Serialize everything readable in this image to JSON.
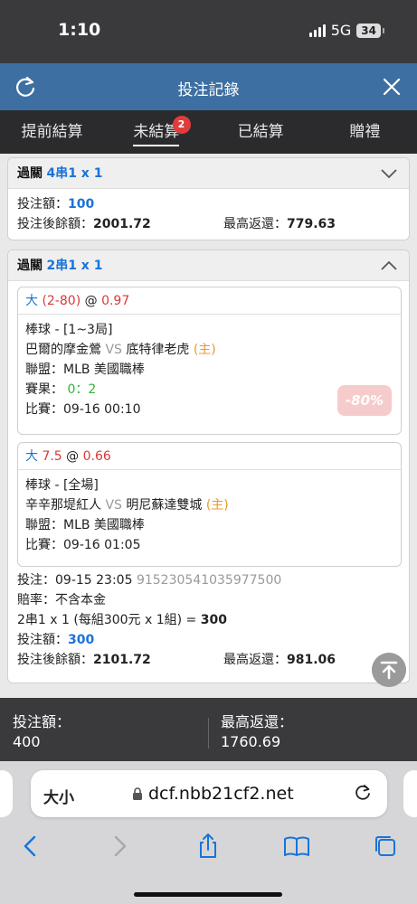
{
  "status": {
    "time": "1:10",
    "network": "5G",
    "battery": "34"
  },
  "header": {
    "title": "投注記錄"
  },
  "tabs": [
    {
      "label": "提前結算"
    },
    {
      "label": "未結算",
      "badge": "2"
    },
    {
      "label": "已結算"
    },
    {
      "label": "贈禮"
    }
  ],
  "card1": {
    "type": "過關",
    "combo": "4串1 x 1",
    "stake_label": "投注額：",
    "stake": "100",
    "balance_label": "投注後餘額：",
    "balance": "2001.72",
    "max_return_label": "最高返還：",
    "max_return": "779.63"
  },
  "card2": {
    "type": "過關",
    "combo": "2串1 x 1",
    "legs": [
      {
        "pick": "大",
        "line": "(2-80)",
        "at": "@",
        "odds": "0.97",
        "sport": "棒球 - [1~3局]",
        "home": "巴爾的摩金鶯",
        "vs": "VS",
        "away": "底特律老虎",
        "host": "(主)",
        "league": "聯盟：MLB 美國職棒",
        "result_label": "賽果：",
        "result": "0：2",
        "match": "比賽：09-16 00:10",
        "stamp": "-80%"
      },
      {
        "pick": "大",
        "line": "7.5",
        "at": "@",
        "odds": "0.66",
        "sport": "棒球 - [全場]",
        "home": "辛辛那堤紅人",
        "vs": "VS",
        "away": "明尼蘇達雙城",
        "host": "(主)",
        "league": "聯盟：MLB 美國職棒",
        "match": "比賽：09-16 01:05"
      }
    ],
    "bet_time": "投注：09-15 23:05",
    "bet_id": "915230541035977500",
    "odds_note": "賠率：不含本金",
    "combo_calc": "2串1 x 1 (每組300元 x 1組) = ",
    "combo_total": "300",
    "stake_label": "投注額：",
    "stake": "300",
    "balance_label": "投注後餘額：",
    "balance": "2101.72",
    "max_return_label": "最高返還：",
    "max_return": "981.06"
  },
  "summary": {
    "stake_label": "投注額：",
    "stake": "400",
    "return_label": "最高返還：",
    "return": "1760.69"
  },
  "browser": {
    "text_size": "大小",
    "url": "dcf.nbb21cf2.net"
  },
  "colors": {
    "header_blue": "#3d6fa3",
    "accent_blue": "#1a73d8",
    "red": "#d83a3a",
    "green": "#34b23a",
    "orange": "#e89a2a"
  }
}
